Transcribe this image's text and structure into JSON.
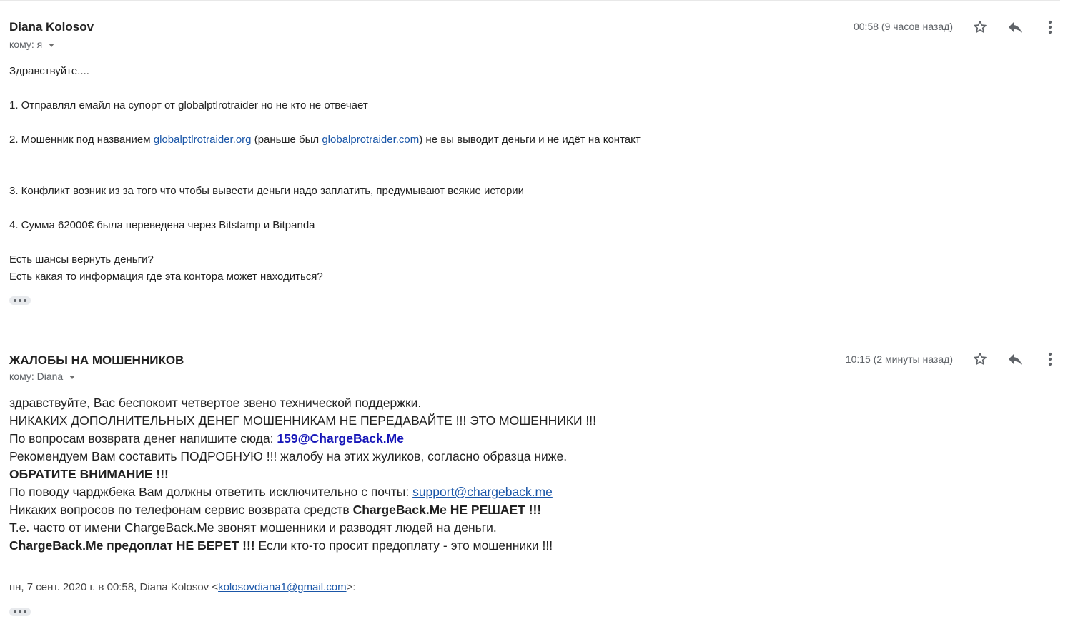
{
  "messages": [
    {
      "sender": "Diana Kolosov",
      "recipient": "кому: я",
      "timestamp": "00:58 (9 часов назад)",
      "body": {
        "greeting": "Здравствуйте....",
        "p1": "1. Отправлял емайл на супорт от globalptlrotraider но не кто не отвечает",
        "p2_pre": "2. Мошенник под названием ",
        "p2_link1": "globalptlrotraider.org",
        "p2_mid": " (раньше был ",
        "p2_link2": "globalprotraider.com",
        "p2_post": ") не вы выводит деньги и не идёт на контакт",
        "p3": "3. Конфликт возник из за того что чтобы вывести деньги надо заплатить, предумывают всякие истории",
        "p4": "4. Сумма 62000€ была переведена через Bitstamp и Bitpanda",
        "q1": "Есть шансы вернуть деньги?",
        "q2": "Есть какая то информация где эта контора может находиться?"
      }
    },
    {
      "sender": "ЖАЛОБЫ НА МОШЕННИКОВ",
      "recipient": "кому: Diana",
      "timestamp": "10:15 (2 минуты назад)",
      "body": {
        "l1": "здравствуйте, Вас беспокоит четвертое звено технической поддержки.",
        "l2": "НИКАКИХ ДОПОЛНИТЕЛЬНЫХ ДЕНЕГ МОШЕННИКАМ НЕ ПЕРЕДАВАЙТЕ !!! ЭТО МОШЕННИКИ !!!",
        "l3_pre": "По вопросам возврата денег напишите сюда: ",
        "l3_email": "159@ChargeBack.Me",
        "l4": "Рекомендуем Вам составить ПОДРОБНУЮ !!! жалобу на этих жуликов, согласно образца ниже.",
        "l5": "ОБРАТИТЕ ВНИМАНИЕ !!!",
        "l6_pre": "По поводу чарджбека Вам должны ответить исключительно с почты: ",
        "l6_link": "support@chargeback.me",
        "l7_pre": "Никаких вопросов по телефонам сервис возврата средств ",
        "l7_bold": "ChargeBack.Me НЕ РЕШАЕТ !!!",
        "l8": "Т.е. часто от имени ChargeBack.Me звонят мошенники и разводят людей на деньги.",
        "l9_bold": "ChargeBack.Me предоплат НЕ БЕРЕТ !!!",
        "l9_post": " Если кто-то просит предоплату - это мошенники !!!"
      },
      "quote": {
        "pre": "пн, 7 сент. 2020 г. в 00:58, Diana Kolosov <",
        "email": "kolosovdiana1@gmail.com",
        "post": ">:"
      }
    }
  ],
  "icons": [
    "star-icon",
    "reply-icon",
    "more-vert-icon",
    "chevron-down-icon",
    "ellipsis-icon"
  ],
  "colors": {
    "link": "#1a56a8",
    "email_highlight": "#1515b8",
    "secondary_text": "#5f6368",
    "divider": "#e4e4e4"
  }
}
